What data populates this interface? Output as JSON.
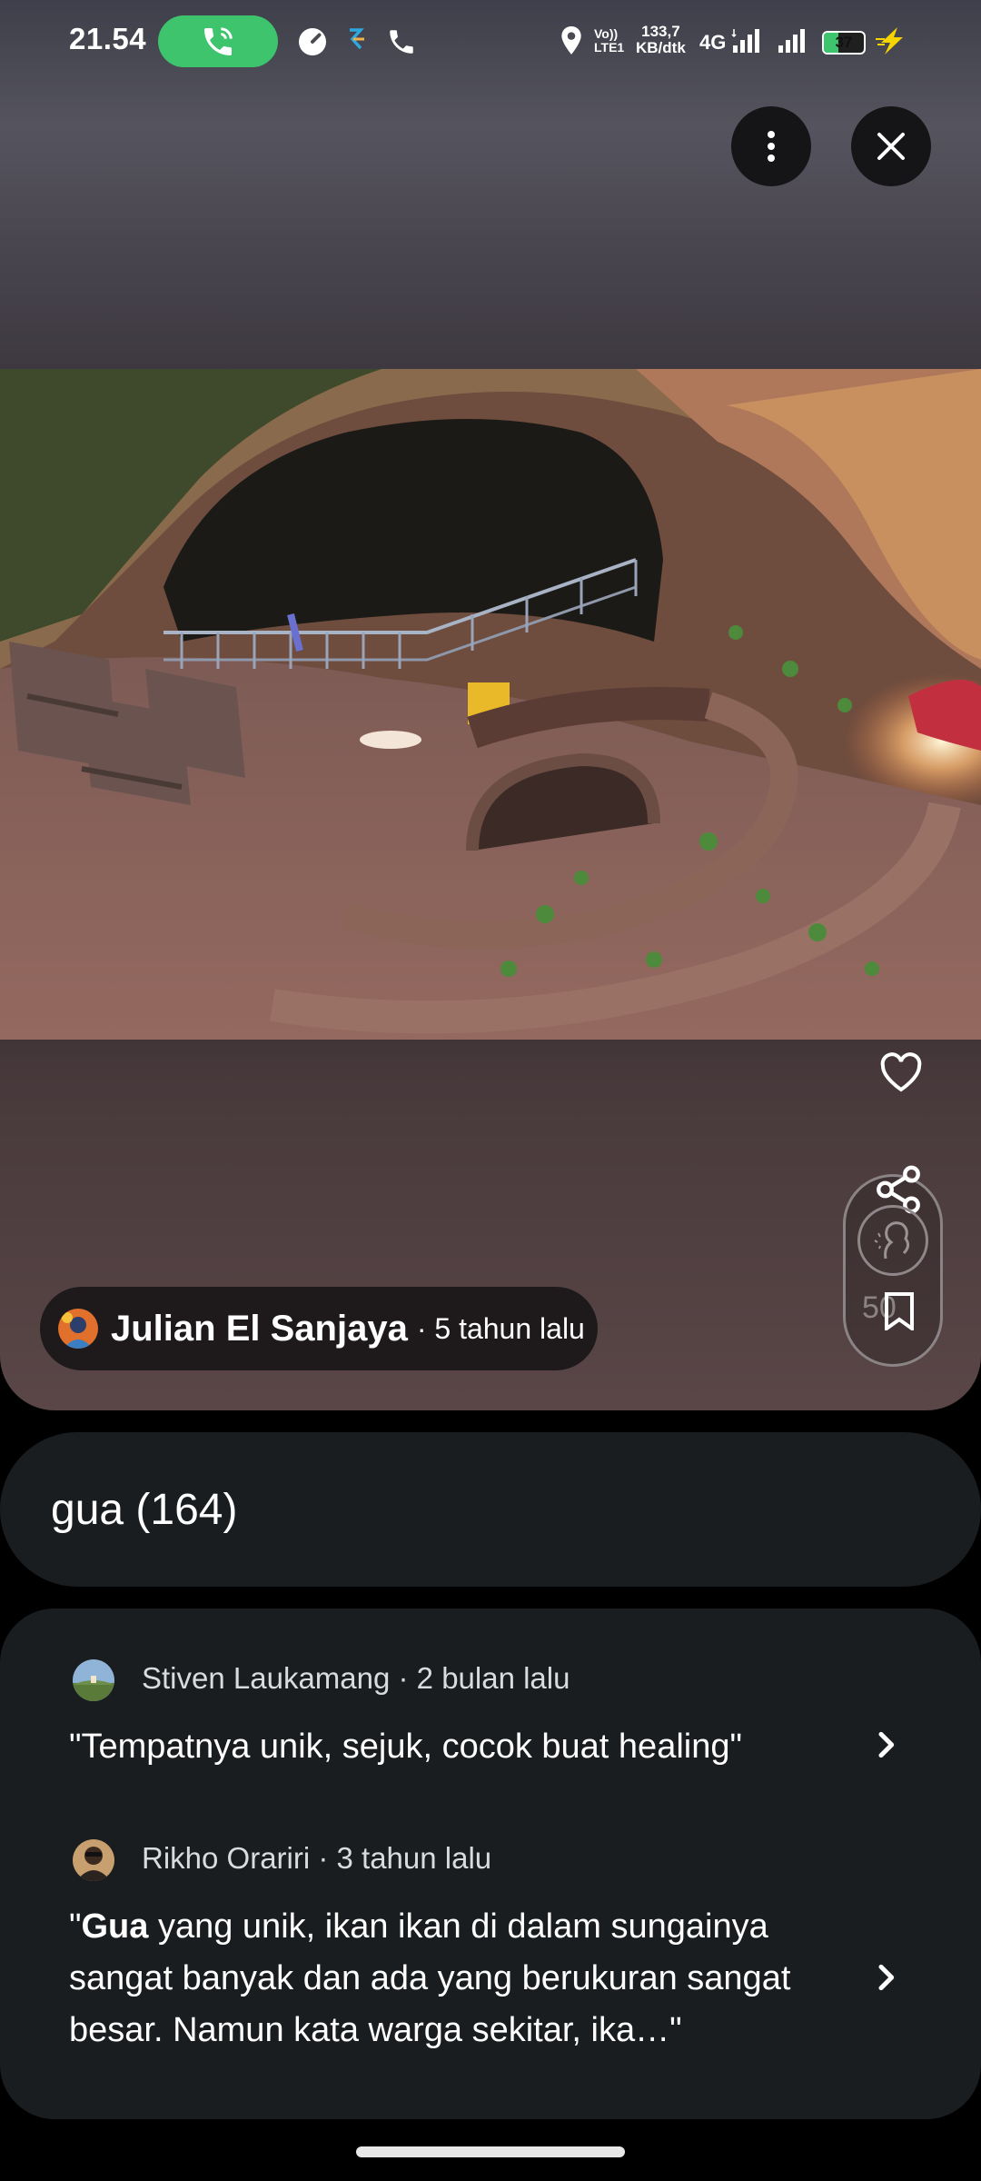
{
  "status_bar": {
    "time": "21.54",
    "lte_label_top": "Vo))",
    "lte_label_bottom": "LTE1",
    "net_speed_value": "133,7",
    "net_speed_unit": "KB/dtk",
    "network_type": "4G",
    "battery_level": "37",
    "battery_fraction": 0.37,
    "icons": [
      "phone-call-icon",
      "speedometer-icon",
      "app-r-icon",
      "phone-icon",
      "location-pin-icon",
      "signal-icon",
      "signal-icon",
      "battery-icon",
      "charging-bolt-icon"
    ]
  },
  "viewer": {
    "menu_icon": "more-vert-icon",
    "close_icon": "close-icon",
    "like_icon": "heart-outline-icon",
    "share_icon": "share-icon",
    "bookmark_icon": "bookmark-icon",
    "partial_number": "50"
  },
  "author": {
    "name": "Julian El Sanjaya",
    "meta": "· 5 tahun lalu"
  },
  "topic": {
    "label": "gua (164)"
  },
  "reviews": [
    {
      "reviewer": "Stiven Laukamang · 2 bulan lalu",
      "quote": "\"Tempatnya unik, sejuk, cocok buat healing\""
    },
    {
      "reviewer": "Rikho Orariri · 3 tahun lalu",
      "quote_open": "\"",
      "quote_highlight": "Gua",
      "quote_rest": " yang unik, ikan ikan di dalam sungainya sangat banyak dan ada yang berukuran sangat besar. Namun kata warga sekitar, ika…\""
    }
  ],
  "colors": {
    "call_green": "#3ec46d",
    "card_bg": "#1a1d1f",
    "bolt_yellow": "#f5d400"
  }
}
